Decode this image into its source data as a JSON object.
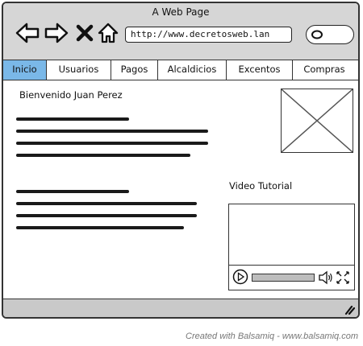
{
  "window": {
    "title": "A Web Page"
  },
  "toolbar": {
    "back_icon": "back-arrow-icon",
    "forward_icon": "forward-arrow-icon",
    "stop_icon": "close-icon",
    "home_icon": "home-icon",
    "url": "http://www.decretosweb.lan",
    "search_icon": "search-icon"
  },
  "tabs": [
    {
      "label": "Inicio",
      "active": true
    },
    {
      "label": "Usuarios",
      "active": false
    },
    {
      "label": "Pagos",
      "active": false
    },
    {
      "label": "Alcaldicios",
      "active": false
    },
    {
      "label": "Excentos",
      "active": false
    },
    {
      "label": "Compras",
      "active": false
    }
  ],
  "content": {
    "welcome": "Bienvenido Juan Perez",
    "video_title": "Video Tutorial"
  },
  "footer": {
    "credit": "Created with Balsamiq - www.balsamiq.com"
  },
  "colors": {
    "active_tab": "#7ab8e8",
    "chrome": "#d6d6d6"
  }
}
